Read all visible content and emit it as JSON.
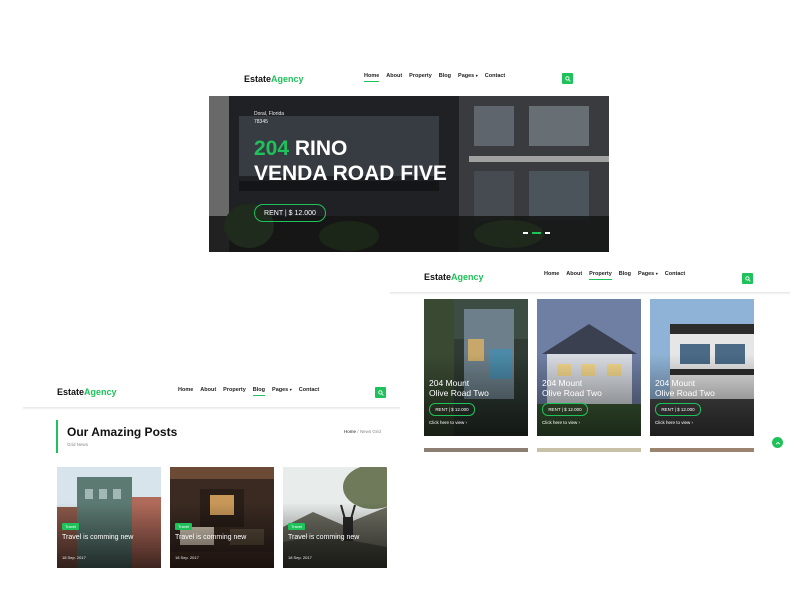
{
  "logo": {
    "part1": "Estate",
    "part2": "Agency"
  },
  "colors": {
    "accent": "#1ec15a"
  },
  "hero_page": {
    "nav": [
      "Home",
      "About",
      "Property",
      "Blog",
      "Pages",
      "Contact"
    ],
    "active": "Home",
    "slide": {
      "address_line1": "Doral, Florida",
      "address_line2": "78345",
      "title_number": "204",
      "title_line1_rest": " RINO",
      "title_line2": "VENDA ROAD FIVE",
      "price": "RENT | $ 12.000"
    }
  },
  "property_page": {
    "nav": [
      "Home",
      "About",
      "Property",
      "Blog",
      "Pages",
      "Contact"
    ],
    "active": "Property",
    "cards": [
      {
        "name_line1": "204 Mount",
        "name_line2": "Olive Road Two",
        "price": "RENT | $ 12.000",
        "link": "Click here to view"
      },
      {
        "name_line1": "204 Mount",
        "name_line2": "Olive Road Two",
        "price": "RENT | $ 12.000",
        "link": "Click here to view"
      },
      {
        "name_line1": "204 Mount",
        "name_line2": "Olive Road Two",
        "price": "RENT | $ 12.000",
        "link": "Click here to view"
      }
    ]
  },
  "blog_page": {
    "nav": [
      "Home",
      "About",
      "Property",
      "Blog",
      "Pages",
      "Contact"
    ],
    "active": "Blog",
    "title": "Our Amazing Posts",
    "subtitle": "Grid News",
    "breadcrumb_home": "Home",
    "breadcrumb_sep": "/",
    "breadcrumb_current": "News Grid",
    "posts": [
      {
        "tag": "Travel",
        "title": "Travel is comming new",
        "date": "18 Sep. 2017"
      },
      {
        "tag": "Travel",
        "title": "Travel is comming new",
        "date": "18 Sep. 2017"
      },
      {
        "tag": "Travel",
        "title": "Travel is comming new",
        "date": "18 Sep. 2017"
      }
    ]
  }
}
